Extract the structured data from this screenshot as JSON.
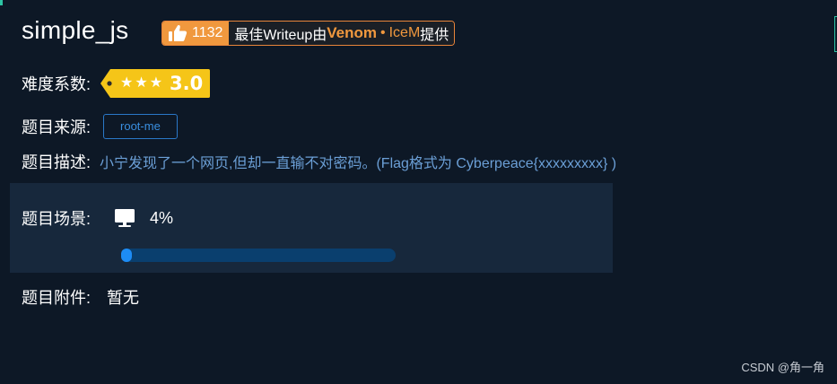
{
  "challenge": {
    "title": "simple_js"
  },
  "writeup_badge": {
    "like_count": "1132",
    "text_prefix": "最佳Writeup由",
    "author_primary": "Venom",
    "separator": "•",
    "author_secondary": "IceM",
    "text_suffix": "提供",
    "accent_color": "#f0983e"
  },
  "difficulty": {
    "label": "难度系数:",
    "stars": 3,
    "value": "3.0",
    "badge_color": "#f5c518"
  },
  "source": {
    "label": "题目来源:",
    "tag": "root-me"
  },
  "description": {
    "label": "题目描述:",
    "text": "小宁发现了一个网页,但却一直输不对密码。(Flag格式为 Cyberpeace{xxxxxxxxx} )"
  },
  "scene": {
    "label": "题目场景:",
    "icon": "monitor-icon",
    "progress_text": "4%",
    "progress_value": 0.04
  },
  "attachment": {
    "label": "题目附件:",
    "value": "暂无"
  },
  "watermark": "CSDN @角一角"
}
